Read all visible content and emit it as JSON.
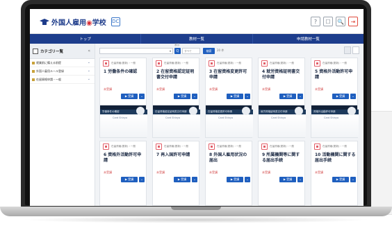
{
  "app": {
    "logo_text_1": "外国人雇用",
    "logo_text_2": "学校",
    "logo_badge": "DC",
    "header_icons": [
      "?",
      "☐",
      "🔍",
      "⇥"
    ]
  },
  "nav": {
    "items": [
      "トップ",
      "教材一覧",
      "申請教材一覧"
    ]
  },
  "sidebar": {
    "title": "カテゴリー覧",
    "close": "«",
    "items": [
      {
        "label": "就業前に備える前提"
      },
      {
        "label": "外国人雇用ルール登録"
      },
      {
        "label": "在留資格申請・一般"
      }
    ]
  },
  "toolbar": {
    "select_value": "",
    "select_arrow": "▾",
    "search_icon": "Q",
    "label_above": "表示",
    "input_placeholder": "すべて",
    "filter_label": "検索",
    "count_text": "20 件"
  },
  "cards": [
    {
      "category": "在留資格(更新)・一般",
      "title": "1 労働条件の確認",
      "status": "未受講",
      "button": "▶ 受講",
      "thumb_text": "労働条件の確認"
    },
    {
      "category": "在留資格(更新)・一般",
      "title": "2 在留資格認定証明書交付申請",
      "status": "未受講",
      "button": "▶ 受講",
      "thumb_text": "在留資格認定証明書交付申請"
    },
    {
      "category": "在留資格(更新)・一般",
      "title": "3 在留資格変更許可申請",
      "status": "未受講",
      "button": "▶ 受講",
      "thumb_text": "在留資格変更許可申請"
    },
    {
      "category": "在留資格(更新)・一般",
      "title": "4 就労資格証明書交付申請",
      "status": "未受講",
      "button": "▶ 受講",
      "thumb_text": "就労資格証明書交付申請"
    },
    {
      "category": "在留資格(更新)・一般",
      "title": "5 資格外活動許可申請",
      "status": "未受講",
      "button": "▶ 受講",
      "thumb_text": "資格外活動許可申請"
    },
    {
      "category": "在留資格(更新)・一般",
      "title": "6 資格外活動許可申請",
      "status": "未受講",
      "button": "▶ 受講"
    },
    {
      "category": "在留資格(更新)・一般",
      "title": "7 再入国許可申請",
      "status": "未受講",
      "button": "▶ 受講"
    },
    {
      "category": "在留資格(更新)・一般",
      "title": "8 外国人雇用状況の届出",
      "status": "未受講",
      "button": "▶ 受講"
    },
    {
      "category": "在留資格(更新)・一般",
      "title": "9 所属機関等に関する届出手続",
      "status": "未受講",
      "button": "▶ 受講"
    },
    {
      "category": "在留資格(更新)・一般",
      "title": "10 活動機関に関する届出手続",
      "status": "未受講",
      "button": "▶ 受講"
    }
  ],
  "thumb_brand": "Card Shinyo",
  "chevron": "⌄"
}
